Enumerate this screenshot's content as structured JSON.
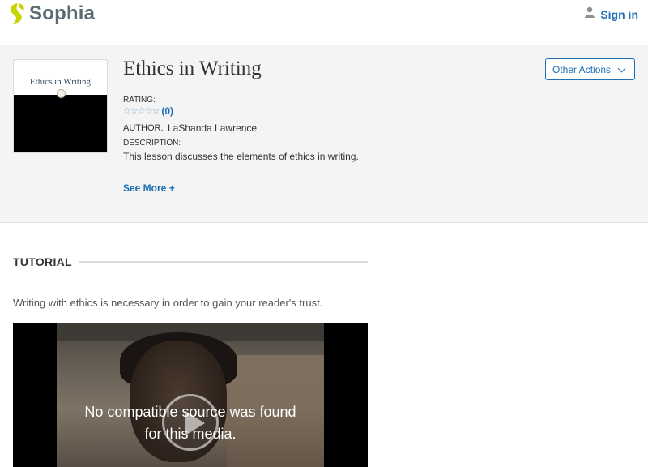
{
  "header": {
    "brand": "Sophia",
    "signin_label": "Sign in"
  },
  "lesson": {
    "thumbnail_title": "Ethics in Writing",
    "title": "Ethics in Writing",
    "rating_label": "RATING:",
    "rating_count": "(0)",
    "rating_stars": 0,
    "author_label": "AUTHOR:",
    "author_name": "LaShanda Lawrence",
    "description_label": "DESCRIPTION:",
    "description": "This lesson discusses the elements of ethics in writing.",
    "see_more": "See More +",
    "other_actions": "Other Actions"
  },
  "tutorial": {
    "section_title": "TUTORIAL",
    "intro": "Writing with ethics is necessary in order to gain your reader's trust.",
    "video_message_line1": "No compatible source was found",
    "video_message_line2": "for this media."
  },
  "colors": {
    "brand_green": "#c8d400",
    "link_blue": "#1f6fb5",
    "hero_bg": "#f4f4f4"
  }
}
